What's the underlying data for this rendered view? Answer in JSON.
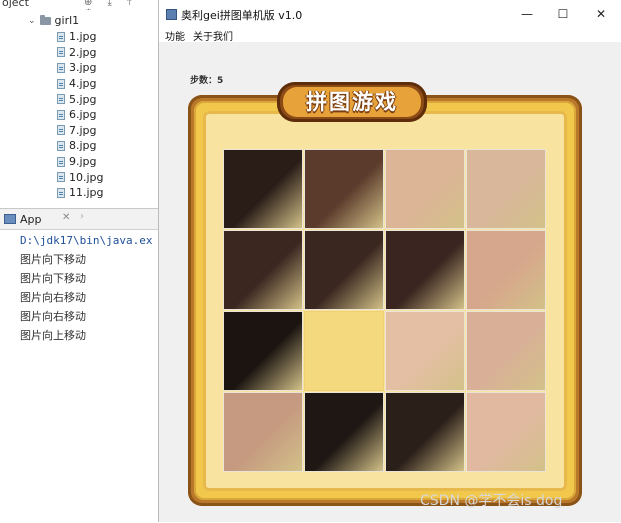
{
  "ide": {
    "project_label": "oject",
    "folder": "girl1",
    "files": [
      "1.jpg",
      "2.jpg",
      "3.jpg",
      "4.jpg",
      "5.jpg",
      "6.jpg",
      "7.jpg",
      "8.jpg",
      "9.jpg",
      "10.jpg",
      "11.jpg"
    ],
    "run_tab": "App",
    "console_command": "D:\\jdk17\\bin\\java.ex",
    "console_lines": [
      "图片向下移动",
      "图片向下移动",
      "图片向右移动",
      "图片向右移动",
      "图片向上移动"
    ]
  },
  "window": {
    "title": "奥利gei拼图单机版 v1.0",
    "min_symbol": "—",
    "max_symbol": "☐",
    "close_symbol": "✕",
    "menus": [
      "功能",
      "关于我们"
    ]
  },
  "game": {
    "steps_label": "步数：",
    "steps_value": "5",
    "banner_text": "拼图游戏",
    "empty_tile": {
      "row": 2,
      "col": 1
    },
    "tile_colors": [
      [
        "#2a1d18",
        "#5b3b2c",
        "#dcb496",
        "#d8b79a"
      ],
      [
        "#3b2720",
        "#3a2720",
        "#3a2520",
        "#d6a78c"
      ],
      [
        "#1b1411",
        "#f4d97f",
        "#e4bfa3",
        "#d9b097"
      ],
      [
        "#c59a80",
        "#1f1714",
        "#2b1f1a",
        "#e0b9a0"
      ]
    ],
    "accent_colors": {
      "frame": "#f1c84b",
      "frame_dark": "#b9782a",
      "banner": "#e7a23a"
    }
  },
  "watermark": "CSDN @学不会is dog"
}
